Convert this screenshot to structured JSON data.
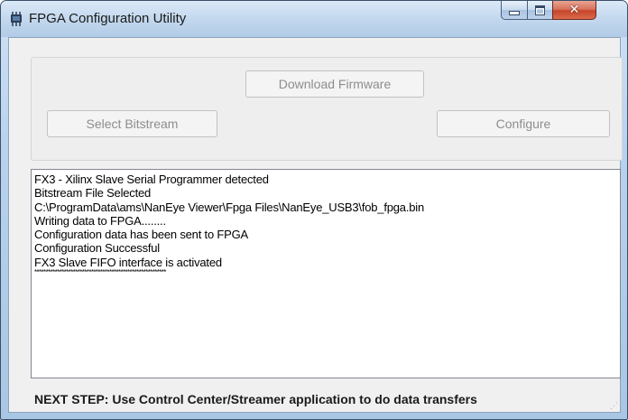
{
  "window": {
    "title": "FPGA Configuration Utility"
  },
  "buttons": {
    "download_firmware": "Download Firmware",
    "select_bitstream": "Select Bitstream",
    "configure": "Configure"
  },
  "log": {
    "lines": [
      "FX3 - Xilinx Slave Serial Programmer detected",
      "Bitstream File Selected",
      "C:\\ProgramData\\ams\\NanEye Viewer\\Fpga Files\\NanEye_USB3\\fob_fpga.bin",
      "Writing data to FPGA........",
      "Configuration data has been sent to FPGA",
      "Configuration Successful",
      "FX3 Slave FIFO interface is activated",
      "**********************************************************"
    ]
  },
  "status": {
    "text": "NEXT STEP: Use Control Center/Streamer application to do data transfers"
  },
  "icons": {
    "app": "fpga-chip-icon",
    "minimize": "minimize-icon",
    "maximize": "maximize-icon",
    "close": "close-icon",
    "grip": "resize-grip-icon"
  },
  "colors": {
    "title_bar": "#c3d8ee",
    "close_button": "#c7452b",
    "client_background": "#f0f0f0",
    "disabled_text": "#8d8d8d"
  }
}
